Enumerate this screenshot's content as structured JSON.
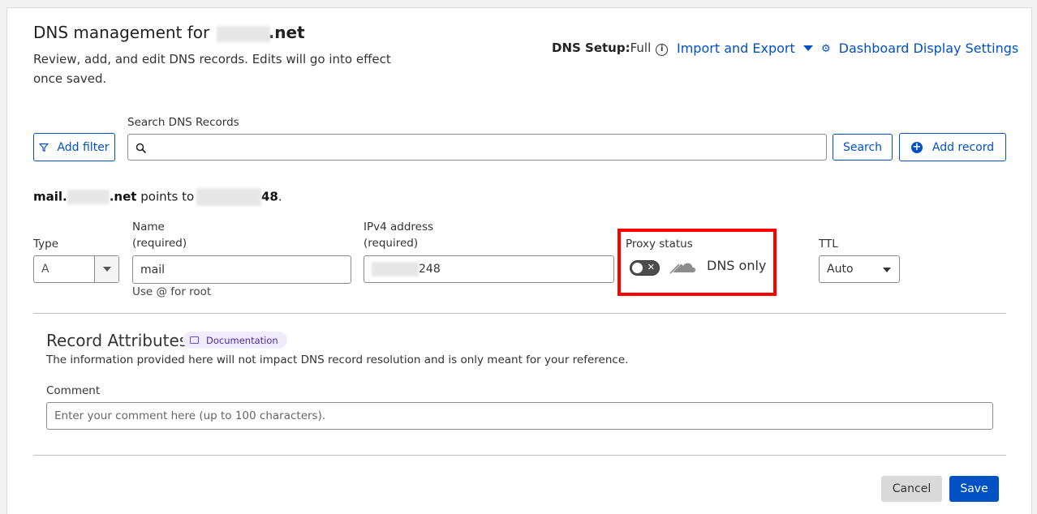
{
  "header": {
    "title_prefix": "DNS management for",
    "title_domain_suffix": ".net",
    "subtitle": "Review, add, and edit DNS records. Edits will go into effect once saved.",
    "dns_setup_label": "DNS Setup:",
    "dns_setup_value": "Full",
    "import_export": "Import and Export",
    "dashboard_settings": "Dashboard Display Settings"
  },
  "toolbar": {
    "add_filter": "Add filter",
    "search_label": "Search DNS Records",
    "search_value": "",
    "search_button": "Search",
    "add_record": "Add record"
  },
  "summary": {
    "name_prefix": "mail.",
    "name_suffix": ".net",
    "points_to": "points to",
    "ip_suffix": "48",
    "period": "."
  },
  "record_form": {
    "type_label": "Type",
    "type_value": "A",
    "name_label": "Name",
    "name_required": "(required)",
    "name_value": "mail",
    "name_help": "Use @ for root",
    "ipv4_label": "IPv4 address",
    "ipv4_required": "(required)",
    "ipv4_suffix": "248",
    "proxy_label": "Proxy status",
    "proxy_value": "DNS only",
    "proxy_enabled": false,
    "ttl_label": "TTL",
    "ttl_value": "Auto"
  },
  "attributes": {
    "title": "Record Attributes",
    "doc_badge": "Documentation",
    "description": "The information provided here will not impact DNS record resolution and is only meant for your reference.",
    "comment_label": "Comment",
    "comment_placeholder": "Enter your comment here (up to 100 characters).",
    "comment_value": ""
  },
  "actions": {
    "cancel": "Cancel",
    "save": "Save"
  },
  "colors": {
    "accent": "#0051c3",
    "highlight": "#ff0000",
    "badge_bg": "#f1ecfd"
  }
}
